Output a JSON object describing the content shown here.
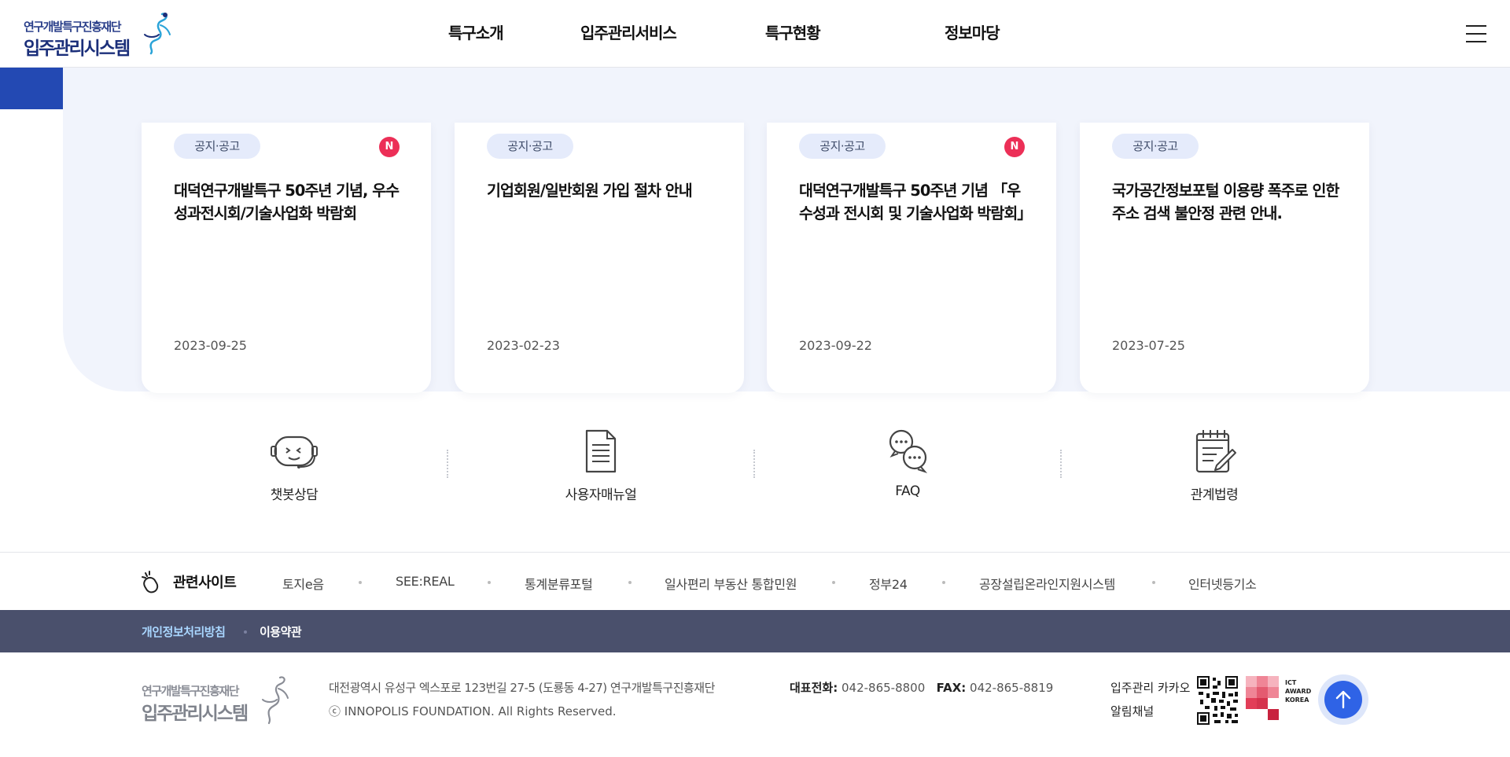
{
  "header": {
    "logo_line1": "연구개발특구진흥재단",
    "logo_line2": "입주관리시스템",
    "nav": [
      "특구소개",
      "입주관리서비스",
      "특구현황",
      "정보마당"
    ]
  },
  "notices": [
    {
      "tag": "공지·공고",
      "is_new": true,
      "new_label": "N",
      "title": "대덕연구개발특구 50주년 기념, 우수성과전시회/기술사업화 박람회",
      "date": "2023-09-25"
    },
    {
      "tag": "공지·공고",
      "is_new": false,
      "title": "기업회원/일반회원 가입 절차 안내",
      "date": "2023-02-23"
    },
    {
      "tag": "공지·공고",
      "is_new": true,
      "new_label": "N",
      "title": "대덕연구개발특구 50주년 기념 「우수성과 전시회 및 기술사업화 박람회」",
      "date": "2023-09-22"
    },
    {
      "tag": "공지·공고",
      "is_new": false,
      "title": "국가공간정보포털 이용량 폭주로 인한 주소 검색 불안정 관련 안내.",
      "date": "2023-07-25"
    }
  ],
  "quick_menu": [
    {
      "label": "챗봇상담",
      "icon": "chatbot-icon"
    },
    {
      "label": "사용자매뉴얼",
      "icon": "document-icon"
    },
    {
      "label": "FAQ",
      "icon": "speech-bubbles-icon"
    },
    {
      "label": "관계법령",
      "icon": "notepad-icon"
    }
  ],
  "related": {
    "title": "관련사이트",
    "icon": "mouse-click-icon",
    "links": [
      "토지e음",
      "SEE:REAL",
      "통계분류포털",
      "일사편리 부동산 통합민원",
      "정부24",
      "공장설립온라인지원시스템",
      "인터넷등기소"
    ]
  },
  "policy": {
    "privacy": "개인정보처리방침",
    "terms": "이용약관"
  },
  "footer": {
    "logo_line1": "연구개발특구진흥재단",
    "logo_line2": "입주관리시스템",
    "address": "대전광역시 유성구 엑스포로 123번길 27-5 (도룡동 4-27) 연구개발특구진흥재단",
    "copyright": "ⓒ INNOPOLIS FOUNDATION. All Rights Reserved.",
    "tel_label": "대표전화:",
    "tel": "042-865-8800",
    "fax_label": "FAX:",
    "fax": "042-865-8819",
    "kakao_line1": "입주관리 카카오",
    "kakao_line2": "알림채널",
    "ict_line1": "ICT",
    "ict_line2": "AWARD",
    "ict_line3": "KOREA"
  },
  "colors": {
    "brand_blue": "#2349b3",
    "new_badge": "#ec2f57",
    "policy_bar": "#4a506c",
    "top_button": "#2f63e6"
  }
}
